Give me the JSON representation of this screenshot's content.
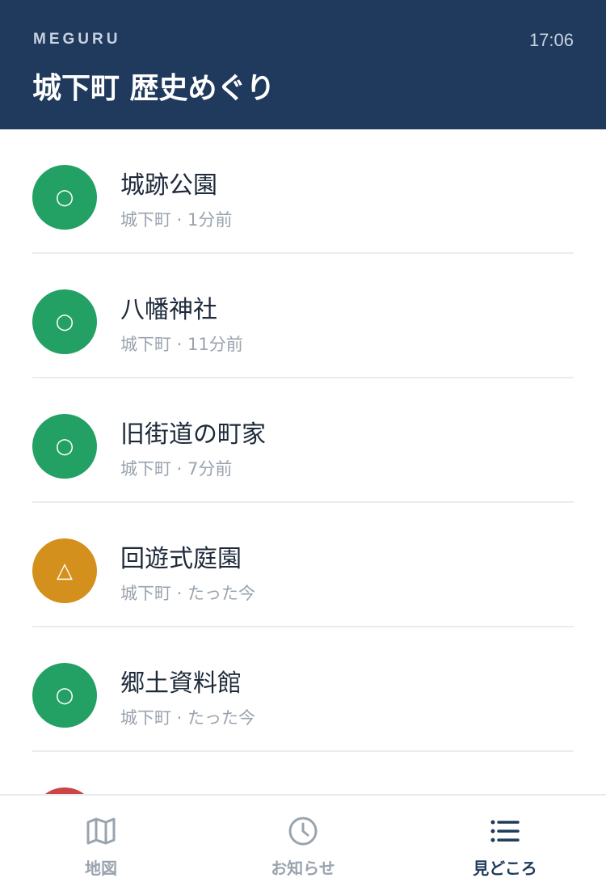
{
  "header": {
    "brand": "MEGURU",
    "time": "17:06",
    "title": "城下町 歴史めぐり"
  },
  "spots": [
    {
      "name": "城跡公園",
      "area": "城下町",
      "ago": "1分前",
      "status": "○",
      "color": "#23a063"
    },
    {
      "name": "八幡神社",
      "area": "城下町",
      "ago": "11分前",
      "status": "○",
      "color": "#23a063"
    },
    {
      "name": "旧街道の町家",
      "area": "城下町",
      "ago": "7分前",
      "status": "○",
      "color": "#23a063"
    },
    {
      "name": "回遊式庭園",
      "area": "城下町",
      "ago": "たった今",
      "status": "△",
      "color": "#d4901c"
    },
    {
      "name": "郷土資料館",
      "area": "城下町",
      "ago": "たった今",
      "status": "○",
      "color": "#23a063"
    },
    {
      "name": "",
      "area": "",
      "ago": "",
      "status": "",
      "color": "#cc4444"
    }
  ],
  "tabs": [
    {
      "label": "地図",
      "icon": "map-icon",
      "active": false
    },
    {
      "label": "お知らせ",
      "icon": "clock-icon",
      "active": false
    },
    {
      "label": "見どころ",
      "icon": "list-icon",
      "active": true
    }
  ],
  "colors": {
    "header_bg": "#1f3a5c",
    "active_tab": "#1f3a5c",
    "inactive_tab": "#9aa3ae"
  }
}
